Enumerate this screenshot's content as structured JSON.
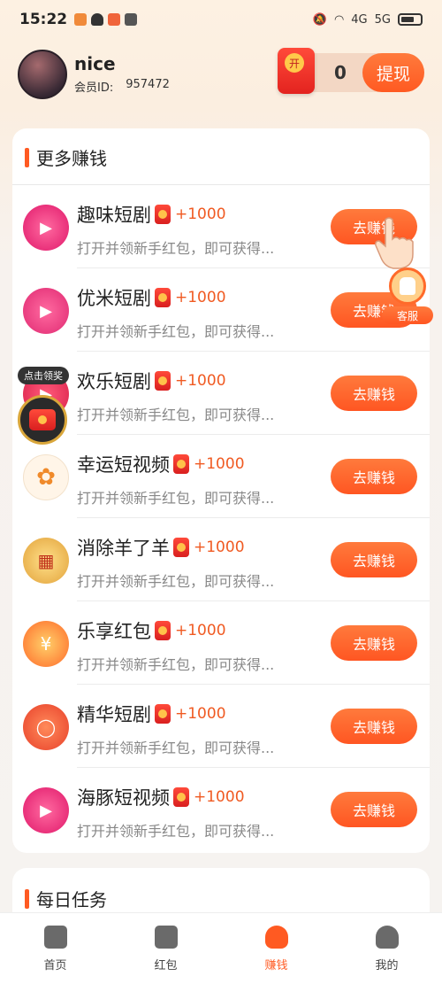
{
  "status_bar": {
    "time": "15:22",
    "network_1": "4G",
    "network_2": "5G"
  },
  "header": {
    "username": "nice",
    "member_id_label": "会员ID:",
    "member_id": "957472",
    "balance": "0",
    "withdraw_label": "提现",
    "redpack_label": "开"
  },
  "section": {
    "title": "更多赚钱"
  },
  "tasks": [
    {
      "name": "趣味短剧",
      "reward": "+1000",
      "desc": "打开并领新手红包，即可获得...",
      "button": "去赚钱"
    },
    {
      "name": "优米短剧",
      "reward": "+1000",
      "desc": "打开并领新手红包，即可获得...",
      "button": "去赚钱"
    },
    {
      "name": "欢乐短剧",
      "reward": "+1000",
      "desc": "打开并领新手红包，即可获得...",
      "button": "去赚钱"
    },
    {
      "name": "幸运短视频",
      "reward": "+1000",
      "desc": "打开并领新手红包，即可获得...",
      "button": "去赚钱"
    },
    {
      "name": "消除羊了羊",
      "reward": "+1000",
      "desc": "打开并领新手红包，即可获得...",
      "button": "去赚钱"
    },
    {
      "name": "乐享红包",
      "reward": "+1000",
      "desc": "打开并领新手红包，即可获得...",
      "button": "去赚钱"
    },
    {
      "name": "精华短剧",
      "reward": "+1000",
      "desc": "打开并领新手红包，即可获得...",
      "button": "去赚钱"
    },
    {
      "name": "海豚短视频",
      "reward": "+1000",
      "desc": "打开并领新手红包，即可获得...",
      "button": "去赚钱"
    }
  ],
  "daily": {
    "title": "每日任务"
  },
  "floating": {
    "customer_service": "客服",
    "claim_tip": "点击领奖"
  },
  "nav": [
    {
      "label": "首页"
    },
    {
      "label": "红包"
    },
    {
      "label": "赚钱"
    },
    {
      "label": "我的"
    }
  ],
  "colors": {
    "accent": "#ff5a22",
    "reward": "#f05a22"
  }
}
